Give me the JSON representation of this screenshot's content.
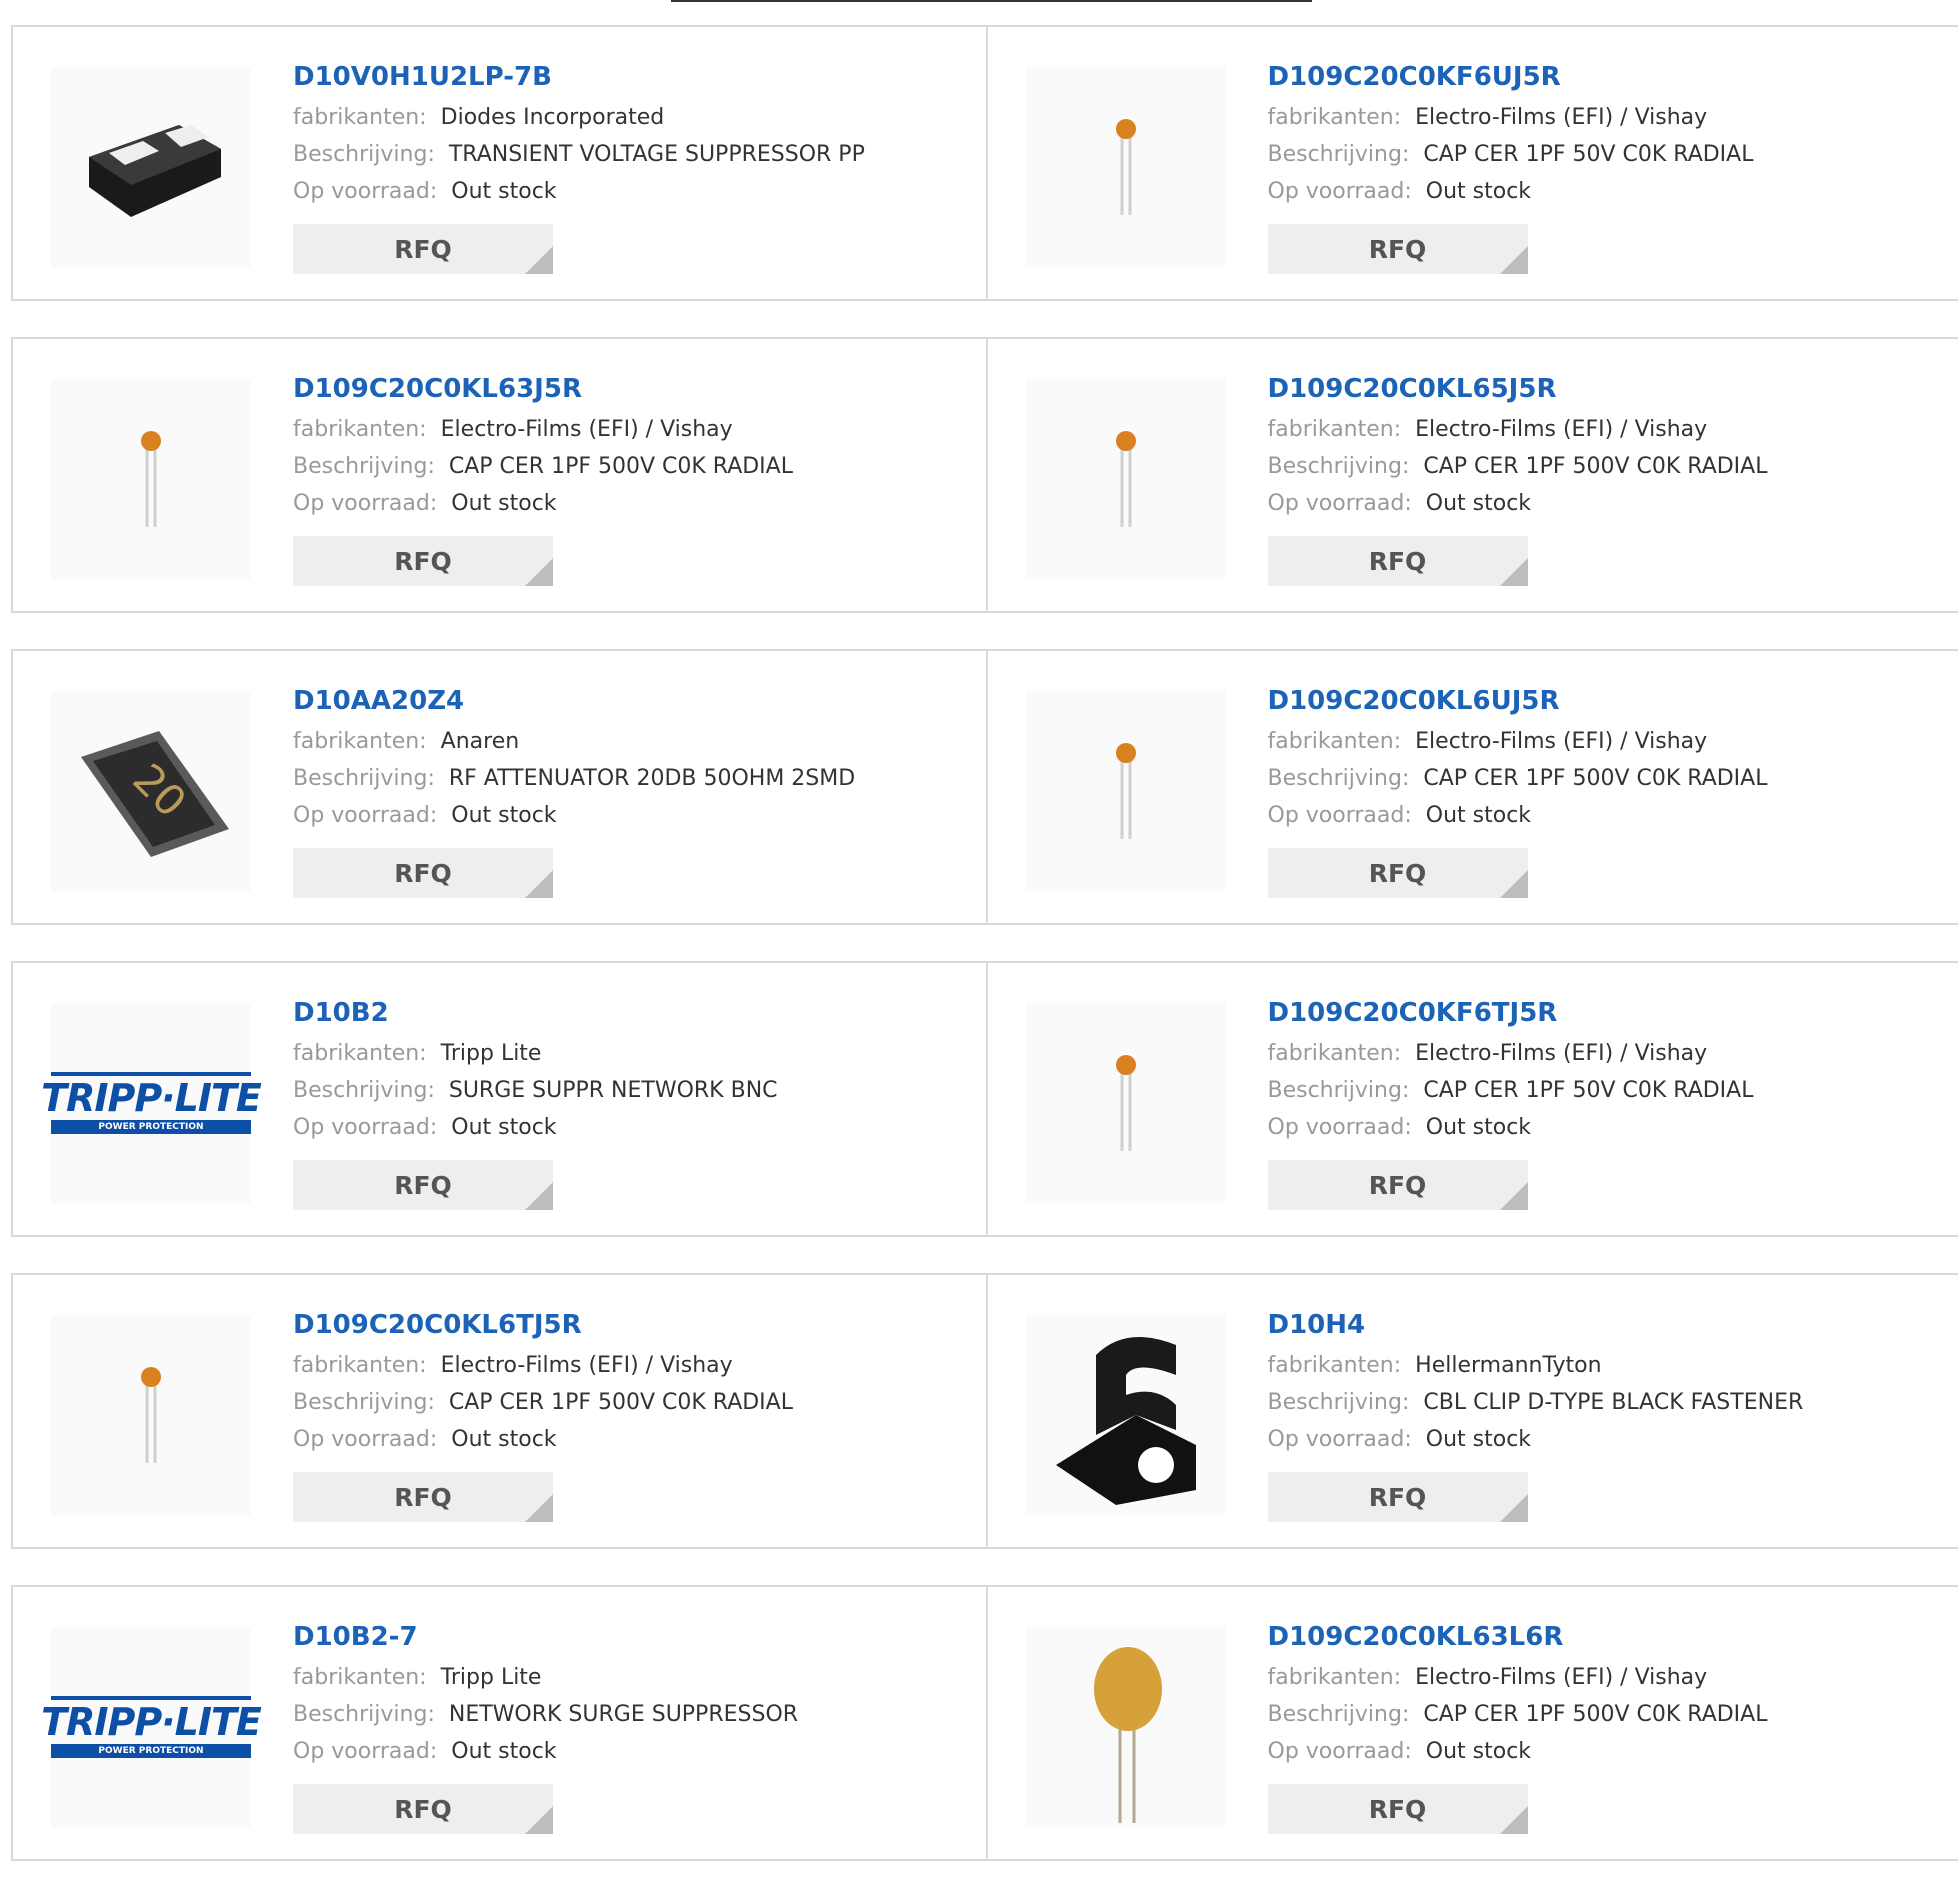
{
  "labels": {
    "manufacturer": "fabrikanten:",
    "description": "Beschrijving:",
    "stock": "Op voorraad:",
    "rfq": "RFQ"
  },
  "products": [
    {
      "pn": "D10V0H1U2LP-7B",
      "mfr": "Diodes Incorporated",
      "desc": "TRANSIENT VOLTAGE SUPPRESSOR PP",
      "stock": "Out stock",
      "image": "smd-diode-package"
    },
    {
      "pn": "D109C20C0KF6UJ5R",
      "mfr": "Electro-Films (EFI) / Vishay",
      "desc": "CAP CER 1PF 50V C0K RADIAL",
      "stock": "Out stock",
      "image": "radial-capacitor-small"
    },
    {
      "pn": "D109C20C0KL63J5R",
      "mfr": "Electro-Films (EFI) / Vishay",
      "desc": "CAP CER 1PF 500V C0K RADIAL",
      "stock": "Out stock",
      "image": "radial-capacitor-small"
    },
    {
      "pn": "D109C20C0KL65J5R",
      "mfr": "Electro-Films (EFI) / Vishay",
      "desc": "CAP CER 1PF 500V C0K RADIAL",
      "stock": "Out stock",
      "image": "radial-capacitor-small"
    },
    {
      "pn": "D10AA20Z4",
      "mfr": "Anaren",
      "desc": "RF ATTENUATOR 20DB 50OHM 2SMD",
      "stock": "Out stock",
      "image": "smd-attenuator",
      "image_text": "20"
    },
    {
      "pn": "D109C20C0KL6UJ5R",
      "mfr": "Electro-Films (EFI) / Vishay",
      "desc": "CAP CER 1PF 500V C0K RADIAL",
      "stock": "Out stock",
      "image": "radial-capacitor-small"
    },
    {
      "pn": "D10B2",
      "mfr": "Tripp Lite",
      "desc": "SURGE SUPPR NETWORK BNC",
      "stock": "Out stock",
      "image": "tripp-lite-logo",
      "image_text": "TRIPP·LITE",
      "image_subtext": "POWER PROTECTION"
    },
    {
      "pn": "D109C20C0KF6TJ5R",
      "mfr": "Electro-Films (EFI) / Vishay",
      "desc": "CAP CER 1PF 50V C0K RADIAL",
      "stock": "Out stock",
      "image": "radial-capacitor-small"
    },
    {
      "pn": "D109C20C0KL6TJ5R",
      "mfr": "Electro-Films (EFI) / Vishay",
      "desc": "CAP CER 1PF 500V C0K RADIAL",
      "stock": "Out stock",
      "image": "radial-capacitor-small"
    },
    {
      "pn": "D10H4",
      "mfr": "HellermannTyton",
      "desc": "CBL CLIP D-TYPE BLACK FASTENER",
      "stock": "Out stock",
      "image": "cable-clip"
    },
    {
      "pn": "D10B2-7",
      "mfr": "Tripp Lite",
      "desc": "NETWORK SURGE SUPPRESSOR",
      "stock": "Out stock",
      "image": "tripp-lite-logo",
      "image_text": "TRIPP·LITE",
      "image_subtext": "POWER PROTECTION"
    },
    {
      "pn": "D109C20C0KL63L6R",
      "mfr": "Electro-Films (EFI) / Vishay",
      "desc": "CAP CER 1PF 500V C0K RADIAL",
      "stock": "Out stock",
      "image": "radial-capacitor-large"
    }
  ],
  "colors": {
    "link": "#1c63b7",
    "label": "#999999",
    "value": "#333333",
    "border": "#d9d9d9",
    "button_bg": "#eeeeee"
  }
}
